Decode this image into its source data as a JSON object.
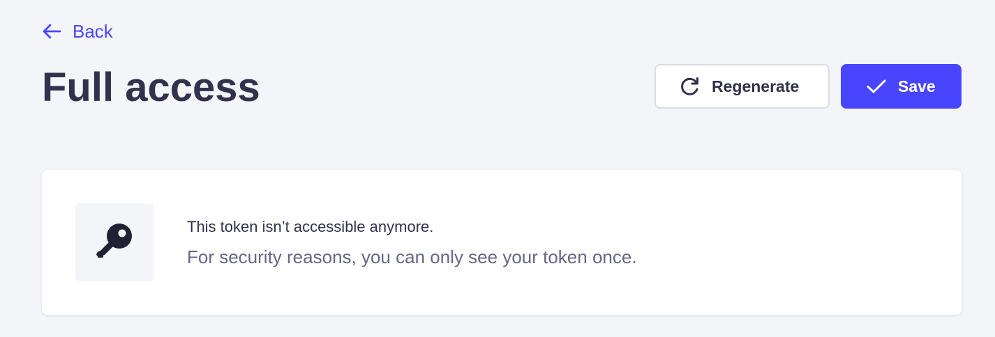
{
  "header": {
    "back_label": "Back",
    "title": "Full access"
  },
  "actions": {
    "regenerate_label": "Regenerate",
    "save_label": "Save"
  },
  "notice": {
    "title": "This token isn’t accessible anymore.",
    "message": "For security reasons, you can only see your token once."
  },
  "icons": {
    "back": "arrow-left-icon",
    "regenerate": "refresh-icon",
    "save": "check-icon",
    "notice": "key-icon"
  },
  "colors": {
    "primary": "#4945ff",
    "text_dark": "#32324d",
    "text_muted": "#666687",
    "background": "#f4f5f9"
  }
}
